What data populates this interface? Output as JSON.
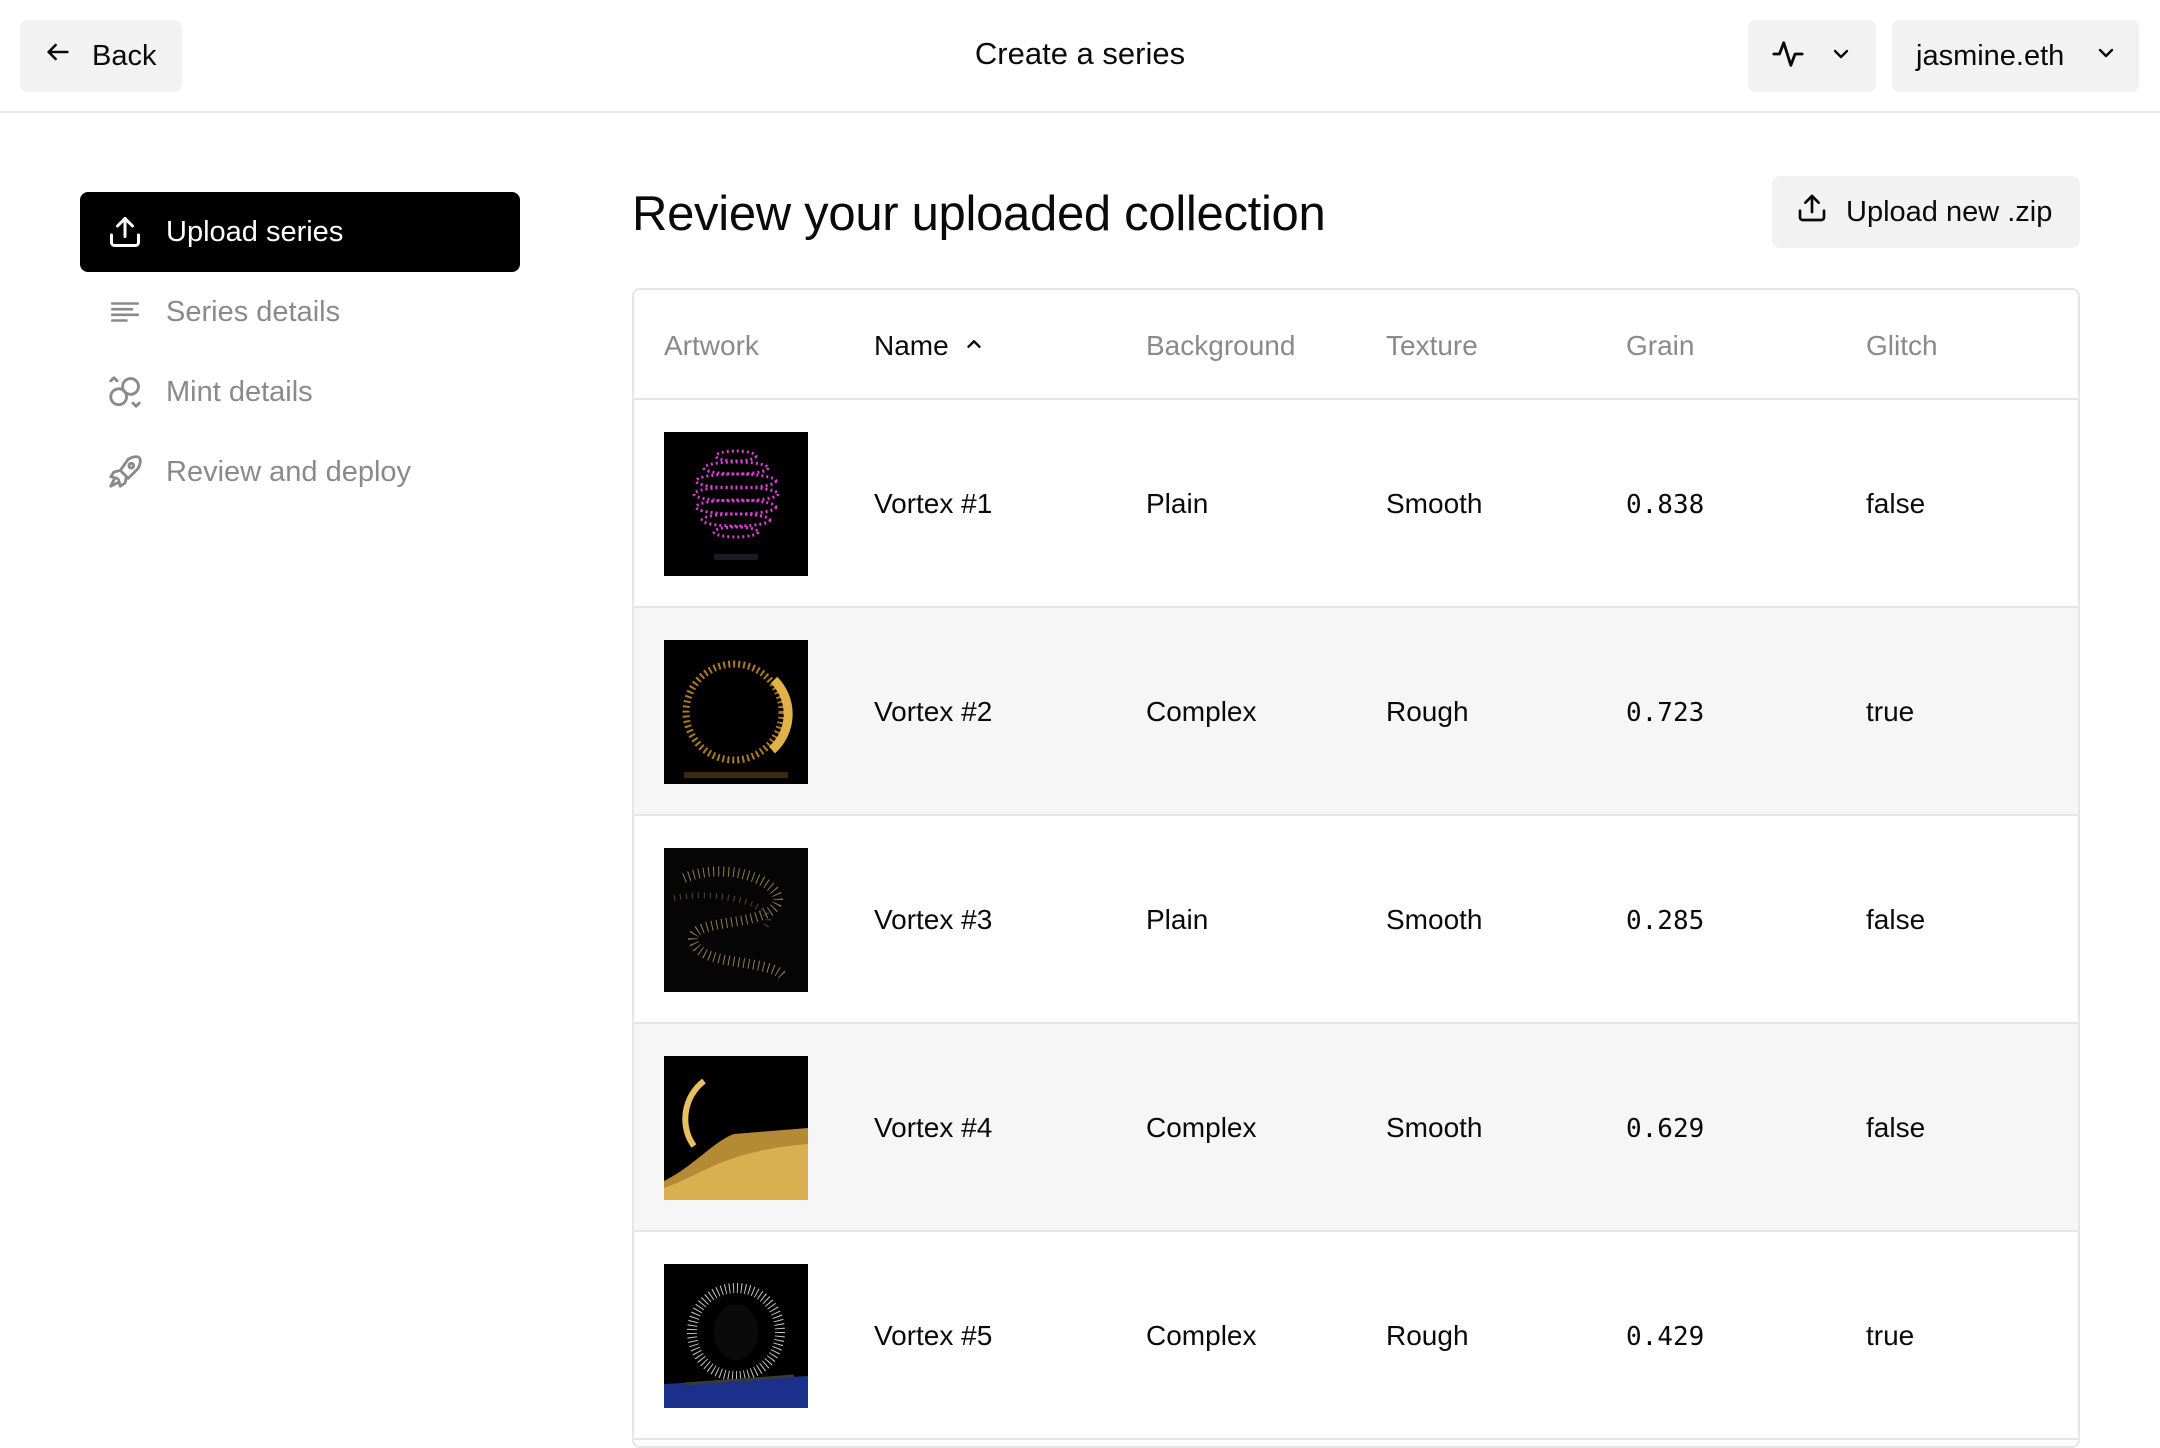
{
  "header": {
    "back_label": "Back",
    "title": "Create a series",
    "activity_icon": "activity-icon",
    "account_label": "jasmine.eth"
  },
  "sidebar": {
    "items": [
      {
        "label": "Upload series",
        "icon": "upload-icon",
        "active": true
      },
      {
        "label": "Series details",
        "icon": "lines-icon",
        "active": false
      },
      {
        "label": "Mint details",
        "icon": "coins-icon",
        "active": false
      },
      {
        "label": "Review and deploy",
        "icon": "rocket-icon",
        "active": false
      }
    ]
  },
  "main": {
    "title": "Review your uploaded collection",
    "upload_button_label": "Upload new .zip"
  },
  "table": {
    "columns": [
      "Artwork",
      "Name",
      "Background",
      "Texture",
      "Grain",
      "Glitch"
    ],
    "sorted_column": "Name",
    "rows": [
      {
        "name": "Vortex #1",
        "background": "Plain",
        "texture": "Smooth",
        "grain": "0.838",
        "glitch": "false"
      },
      {
        "name": "Vortex #2",
        "background": "Complex",
        "texture": "Rough",
        "grain": "0.723",
        "glitch": "true"
      },
      {
        "name": "Vortex #3",
        "background": "Plain",
        "texture": "Smooth",
        "grain": "0.285",
        "glitch": "false"
      },
      {
        "name": "Vortex #4",
        "background": "Complex",
        "texture": "Smooth",
        "grain": "0.629",
        "glitch": "false"
      },
      {
        "name": "Vortex #5",
        "background": "Complex",
        "texture": "Rough",
        "grain": "0.429",
        "glitch": "true"
      }
    ]
  },
  "colors": {
    "accent": "#000000",
    "muted_text": "#8a8a8a",
    "button_bg": "#f2f2f2",
    "row_alt_bg": "#f6f6f6"
  }
}
